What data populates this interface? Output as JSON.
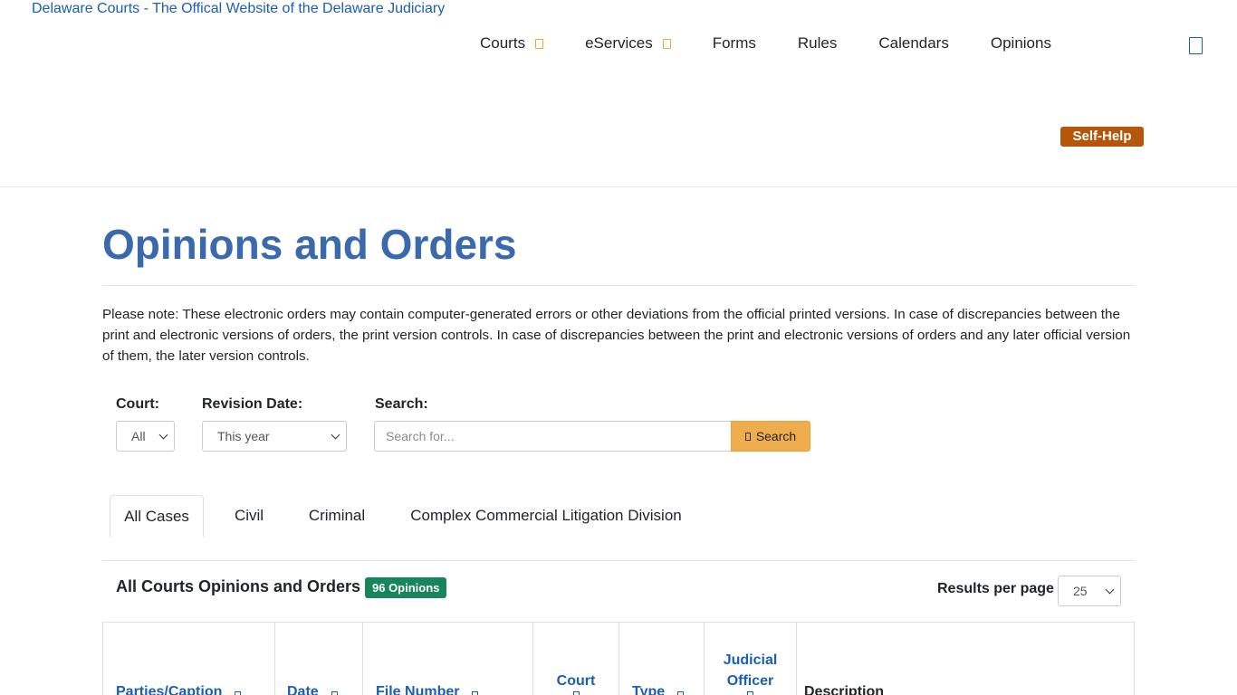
{
  "header": {
    "logo_alt": "Delaware Courts - The Offical Website of the Delaware Judiciary",
    "nav": [
      {
        "label": "Courts",
        "has_dropdown": true
      },
      {
        "label": "eServices",
        "has_dropdown": true
      },
      {
        "label": "Forms",
        "has_dropdown": false
      },
      {
        "label": "Rules",
        "has_dropdown": false
      },
      {
        "label": "Calendars",
        "has_dropdown": false
      },
      {
        "label": "Opinions",
        "has_dropdown": false
      }
    ],
    "self_help": "Self-Help"
  },
  "page": {
    "title_bold": "Opinions",
    "title_rest": "and Orders",
    "notice": "Please note: These electronic orders may contain computer-generated errors or other deviations from the official printed versions. In case of discrepancies between the print and electronic versions of orders, the print version controls. In case of discrepancies between the print and electronic versions of orders and any later official version of them, the later version controls."
  },
  "filters": {
    "court_label": "Court:",
    "court_value": "All",
    "revision_label": "Revision Date:",
    "revision_value": "This year",
    "search_label": "Search:",
    "search_placeholder": "Search for...",
    "search_button": "Search"
  },
  "tabs": [
    "All Cases",
    "Civil",
    "Criminal",
    "Complex Commercial Litigation Division"
  ],
  "results": {
    "title": "All Courts Opinions and Orders",
    "badge": "96 Opinions",
    "per_page_label": "Results per page",
    "per_page_value": "25"
  },
  "table": {
    "headers": [
      "Parties/Caption",
      "Date",
      "File Number",
      "Court",
      "Type",
      "Judicial Officer",
      "Description"
    ]
  },
  "colors": {
    "accent_blue": "#3a6aad",
    "link_blue": "#1a5fb4",
    "self_help": "#b5560a",
    "search_button": "#f0ad4e",
    "badge": "#19855a"
  }
}
